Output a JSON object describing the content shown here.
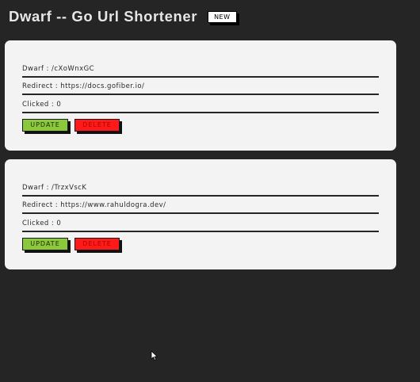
{
  "header": {
    "title": "Dwarf -- Go Url Shortener",
    "new_label": "NEW"
  },
  "links": [
    {
      "dwarf_text": "Dwarf : /cXoWnxGC",
      "redirect_text": "Redirect : https://docs.gofiber.io/",
      "clicked_text": "Clicked : 0",
      "update_label": "UPDATE",
      "delete_label": "DELETE"
    },
    {
      "dwarf_text": "Dwarf : /TrzxVscK",
      "redirect_text": "Redirect : https://www.rahuldogra.dev/",
      "clicked_text": "Clicked : 0",
      "update_label": "UPDATE",
      "delete_label": "DELETE"
    }
  ],
  "icons": {
    "cursor": "mouse-pointer-icon"
  },
  "colors": {
    "background": "#252525",
    "card": "#f3f3f3",
    "update_button": "#8cc83c",
    "delete_button": "#ff1a1a"
  }
}
